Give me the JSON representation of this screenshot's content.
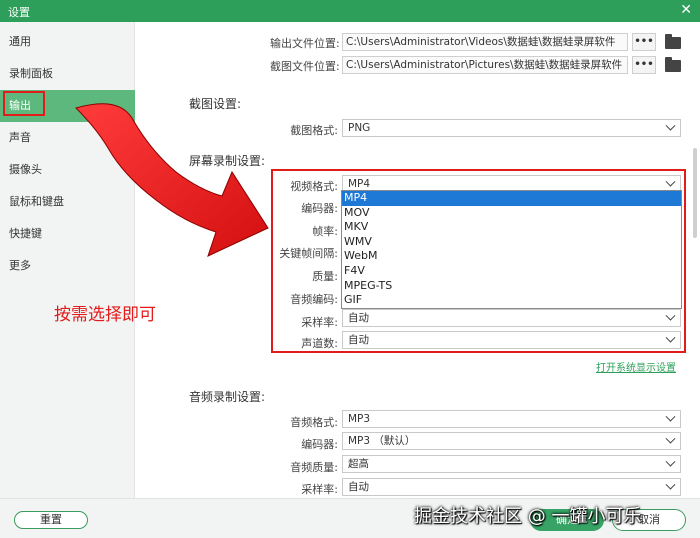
{
  "window": {
    "title": "设置",
    "close_glyph": "✕"
  },
  "sidebar": {
    "items": [
      {
        "label": "通用"
      },
      {
        "label": "录制面板"
      },
      {
        "label": "输出"
      },
      {
        "label": "声音"
      },
      {
        "label": "摄像头"
      },
      {
        "label": "鼠标和键盘"
      },
      {
        "label": "快捷键"
      },
      {
        "label": "更多"
      }
    ],
    "active_index": 2
  },
  "output": {
    "video_path_label": "输出文件位置:",
    "video_path": "C:\\Users\\Administrator\\Videos\\数据蛙\\数据蛙录屏软件",
    "screenshot_path_label": "截图文件位置:",
    "screenshot_path": "C:\\Users\\Administrator\\Pictures\\数据蛙\\数据蛙录屏软件",
    "browse_label": "•••"
  },
  "screenshot": {
    "section_title": "截图设置:",
    "format_label": "截图格式:",
    "format_value": "PNG"
  },
  "recording": {
    "section_title": "屏幕录制设置:",
    "video_format_label": "视频格式:",
    "video_format_value": "MP4",
    "encoder_label": "编码器:",
    "framerate_label": "帧率:",
    "keyframe_label": "关键帧间隔:",
    "quality_label": "质量:",
    "audio_codec_label": "音频编码:",
    "samplerate_label": "采样率:",
    "samplerate_value": "自动",
    "channels_label": "声道数:",
    "channels_value": "自动",
    "format_options": [
      "MP4",
      "MOV",
      "MKV",
      "WMV",
      "WebM",
      "F4V",
      "MPEG-TS",
      "GIF"
    ],
    "selected_option_index": 0,
    "display_settings_link": "打开系统显示设置"
  },
  "audio": {
    "section_title": "音频录制设置:",
    "format_label": "音频格式:",
    "format_value": "MP3",
    "encoder_label": "编码器:",
    "encoder_value": "MP3 （默认）",
    "quality_label": "音频质量:",
    "quality_value": "超高",
    "samplerate_label": "采样率:",
    "samplerate_value": "自动"
  },
  "annotation": {
    "text": "按需选择即可"
  },
  "footer": {
    "reset_label": "重置",
    "ok_label": "确定",
    "cancel_label": "取消",
    "watermark": "掘金技术社区 @ 一罐小可乐"
  },
  "colors": {
    "accent": "#2e9f5a",
    "annotation_red": "#e21b1b",
    "selection_blue": "#1e78d6"
  }
}
